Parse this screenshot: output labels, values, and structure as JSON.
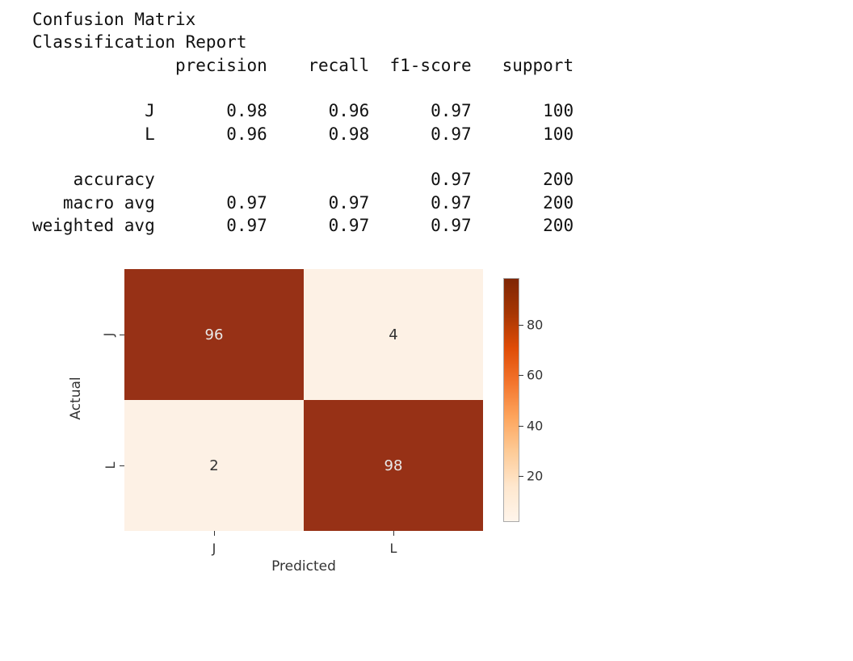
{
  "header1": "Confusion Matrix",
  "header2": "Classification Report",
  "report_header": "              precision    recall  f1-score   support",
  "report_row_J": "           J       0.98      0.96      0.97       100",
  "report_row_L": "           L       0.96      0.98      0.97       100",
  "report_row_acc": "    accuracy                           0.97       200",
  "report_row_mac": "   macro avg       0.97      0.97      0.97       200",
  "report_row_wgt": "weighted avg       0.97      0.97      0.97       200",
  "heatmap": {
    "cells": {
      "c00": "96",
      "c01": "4",
      "c10": "2",
      "c11": "98"
    },
    "xticks": {
      "t0": "J",
      "t1": "L"
    },
    "yticks": {
      "t0": "J",
      "t1": "L"
    },
    "xlabel": "Predicted",
    "ylabel": "Actual",
    "cbar": {
      "t20": "20",
      "t40": "40",
      "t60": "60",
      "t80": "80"
    }
  },
  "chart_data": {
    "type": "heatmap",
    "title": "Confusion Matrix",
    "xlabel": "Predicted",
    "ylabel": "Actual",
    "x_categories": [
      "J",
      "L"
    ],
    "y_categories": [
      "J",
      "L"
    ],
    "matrix": [
      [
        96,
        4
      ],
      [
        2,
        98
      ]
    ],
    "colorbar": {
      "range_ticks": [
        20,
        40,
        60,
        80
      ],
      "cmap": "Oranges"
    },
    "classification_report": {
      "columns": [
        "precision",
        "recall",
        "f1-score",
        "support"
      ],
      "rows": {
        "J": [
          0.98,
          0.96,
          0.97,
          100
        ],
        "L": [
          0.96,
          0.98,
          0.97,
          100
        ],
        "accuracy": [
          null,
          null,
          0.97,
          200
        ],
        "macro avg": [
          0.97,
          0.97,
          0.97,
          200
        ],
        "weighted avg": [
          0.97,
          0.97,
          0.97,
          200
        ]
      }
    }
  }
}
